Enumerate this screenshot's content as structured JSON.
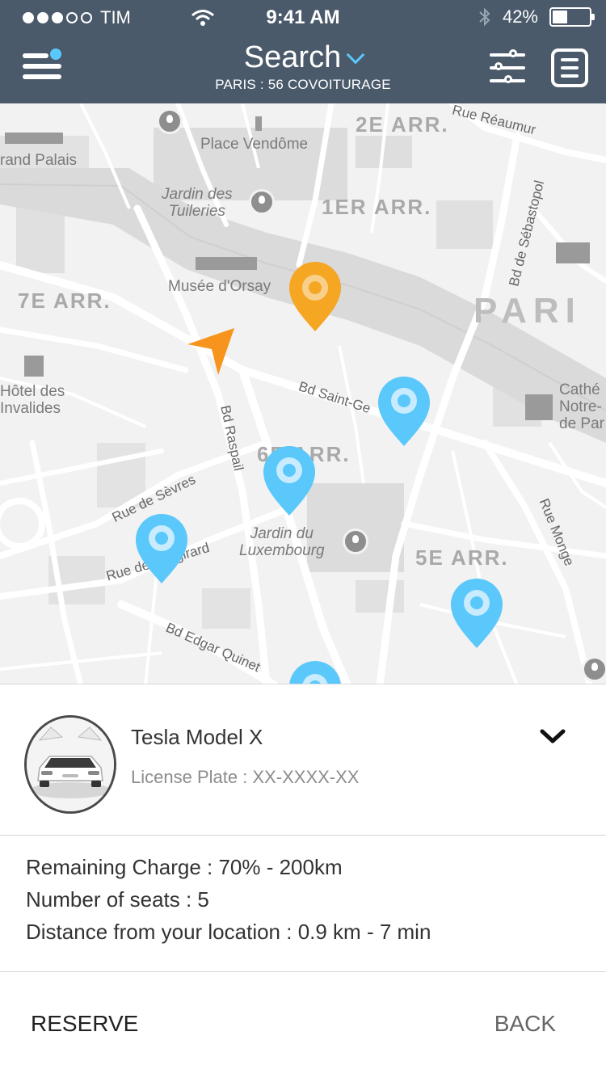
{
  "status_bar": {
    "carrier": "TIM",
    "time": "9:41 AM",
    "battery": "42%",
    "battery_level": 0.42
  },
  "header": {
    "title": "Search",
    "subtitle": "PARIS : 56 COVOITURAGE",
    "icons": [
      "menu-icon",
      "chevron-down-icon",
      "filter-sliders-icon",
      "list-icon"
    ]
  },
  "map": {
    "places": {
      "place_vendome": "Place Vendôme",
      "grand_palais": "rand Palais",
      "jardin_tuileries_1": "Jardin des",
      "jardin_tuileries_2": "Tuileries",
      "musee_orsay": "Musée d'Orsay",
      "hotel_invalides_1": "Hôtel des",
      "hotel_invalides_2": "Invalides",
      "jardin_luxembourg_1": "Jardin du",
      "jardin_luxembourg_2": "Luxembourg",
      "cathedrale_1": "Cathé",
      "cathedrale_2": "Notre-",
      "cathedrale_3": "de Par"
    },
    "districts": {
      "arr2": "2E ARR.",
      "arr1": "1ER ARR.",
      "arr7": "7E ARR.",
      "arr6": "6E ARR.",
      "arr5": "5E ARR.",
      "paris": "PARI"
    },
    "streets": {
      "rue_reaumur": "Rue Réaumur",
      "bd_sebastopol": "Bd de Sébastopol",
      "bd_saint_germain": "Bd Saint-Ge",
      "bd_raspail": "Bd Raspail",
      "rue_sevres": "Rue de Sèvres",
      "rue_vaugirard": "Rue de Vaugirard",
      "rue_monge": "Rue Monge",
      "bd_edgar_quinet": "Bd Edgar Quinet"
    },
    "colors": {
      "selected_pin": "#f5a623",
      "car_pin": "#5ac8fa",
      "location_arrow": "#f7941d"
    }
  },
  "car": {
    "name": "Tesla Model X",
    "plate": "License Plate : XX-XXXX-XX",
    "remaining_charge": "Remaining Charge : 70% - 200km",
    "seats": "Number of seats : 5",
    "distance": "Distance from your location : 0.9 km - 7 min"
  },
  "actions": {
    "reserve": "RESERVE",
    "back": "BACK"
  }
}
